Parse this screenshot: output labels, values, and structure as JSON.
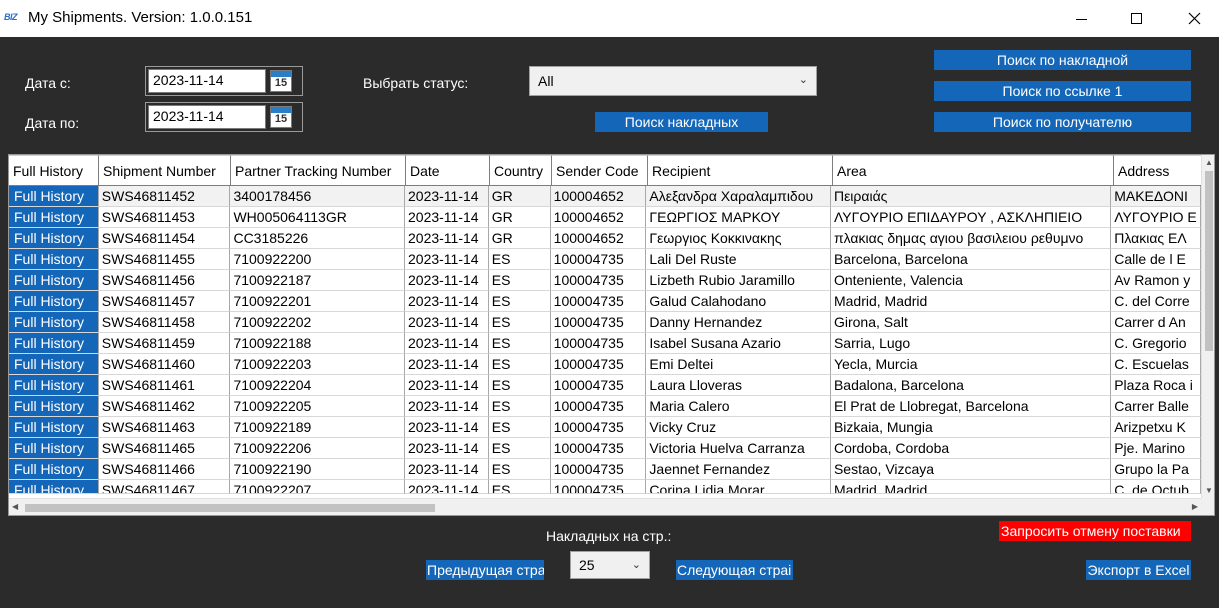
{
  "window": {
    "logo_text": "BIZ",
    "title": "My Shipments. Version: 1.0.0.151"
  },
  "filters": {
    "date_from_label": "Дата с:",
    "date_from_value": "2023-11-14",
    "date_to_label": "Дата по:",
    "date_to_value": "2023-11-14",
    "calendar_number": "15",
    "status_label": "Выбрать статус:",
    "status_value": "All"
  },
  "buttons": {
    "search_waybills": "Поиск накладных",
    "search_by_waybill": "Поиск по накладной",
    "search_by_reference": "Поиск по ссылке 1",
    "search_by_recipient": "Поиск по получателю",
    "prev_page": "Предыдущая стра",
    "next_page": "Следующая страі",
    "request_cancel": "Запросить отмену поставки",
    "export_excel": "Экспорт в Excel"
  },
  "pagination": {
    "per_page_label": "Накладных на стр.:",
    "per_page_value": "25"
  },
  "table": {
    "columns": [
      "Full History",
      "Shipment Number",
      "Partner Tracking Number",
      "Date",
      "Country",
      "Sender Code",
      "Recipient",
      "Area",
      "Address"
    ],
    "rows": [
      [
        "Full History",
        "SWS46811452",
        "3400178456",
        "2023-11-14",
        "GR",
        "100004652",
        "Αλεξανδρα Χαραλαμπιδου",
        "Πειραιάς",
        "ΜΑΚΕΔΟΝΙ"
      ],
      [
        "Full History",
        "SWS46811453",
        "WH005064113GR",
        "2023-11-14",
        "GR",
        "100004652",
        "ΓΕΩΡΓΙΟΣ ΜΑΡΚΟΥ",
        "ΛΥΓΟΥΡΙΟ ΕΠΙΔΑΥΡΟΥ , ΑΣΚΛΗΠΙΕΙΟ",
        "ΛΥΓΟΥΡΙΟ Ε"
      ],
      [
        "Full History",
        "SWS46811454",
        "CC3185226",
        "2023-11-14",
        "GR",
        "100004652",
        "Γεωργιος Κοκκινακης",
        "πλακιας δημας αγιου βασιλειου ρεθυμνο",
        "Πλακιας ΕΛ"
      ],
      [
        "Full History",
        "SWS46811455",
        "7100922200",
        "2023-11-14",
        "ES",
        "100004735",
        "Lali Del Ruste",
        "Barcelona, Barcelona",
        "Calle de l E"
      ],
      [
        "Full History",
        "SWS46811456",
        "7100922187",
        "2023-11-14",
        "ES",
        "100004735",
        "Lizbeth Rubio Jaramillo",
        "Onteniente, Valencia",
        "Av Ramon y"
      ],
      [
        "Full History",
        "SWS46811457",
        "7100922201",
        "2023-11-14",
        "ES",
        "100004735",
        "Galud Calahodano",
        "Madrid, Madrid",
        "C. del Corre"
      ],
      [
        "Full History",
        "SWS46811458",
        "7100922202",
        "2023-11-14",
        "ES",
        "100004735",
        "Danny Hernandez",
        "Girona, Salt",
        "Carrer d An"
      ],
      [
        "Full History",
        "SWS46811459",
        "7100922188",
        "2023-11-14",
        "ES",
        "100004735",
        "Isabel Susana Azario",
        "Sarria, Lugo",
        "C. Gregorio"
      ],
      [
        "Full History",
        "SWS46811460",
        "7100922203",
        "2023-11-14",
        "ES",
        "100004735",
        "Emi Deltei",
        "Yecla, Murcia",
        "C. Escuelas"
      ],
      [
        "Full History",
        "SWS46811461",
        "7100922204",
        "2023-11-14",
        "ES",
        "100004735",
        "Laura Lloveras",
        "Badalona, Barcelona",
        "Plaza Roca i"
      ],
      [
        "Full History",
        "SWS46811462",
        "7100922205",
        "2023-11-14",
        "ES",
        "100004735",
        "Maria Calero",
        "El Prat de Llobregat, Barcelona",
        "Carrer Balle"
      ],
      [
        "Full History",
        "SWS46811463",
        "7100922189",
        "2023-11-14",
        "ES",
        "100004735",
        "Vicky Cruz",
        "Bizkaia, Mungia",
        "Arizpetxu K"
      ],
      [
        "Full History",
        "SWS46811465",
        "7100922206",
        "2023-11-14",
        "ES",
        "100004735",
        "Victoria Huelva Carranza",
        "Cordoba, Cordoba",
        "Pje. Marino"
      ],
      [
        "Full History",
        "SWS46811466",
        "7100922190",
        "2023-11-14",
        "ES",
        "100004735",
        "Jaennet Fernandez",
        "Sestao, Vizcaya",
        "Grupo la Pa"
      ],
      [
        "Full History",
        "SWS46811467",
        "7100922207",
        "2023-11-14",
        "ES",
        "100004735",
        "Corina Lidia Morar",
        "Madrid, Madrid",
        "C. de Octub"
      ]
    ]
  }
}
